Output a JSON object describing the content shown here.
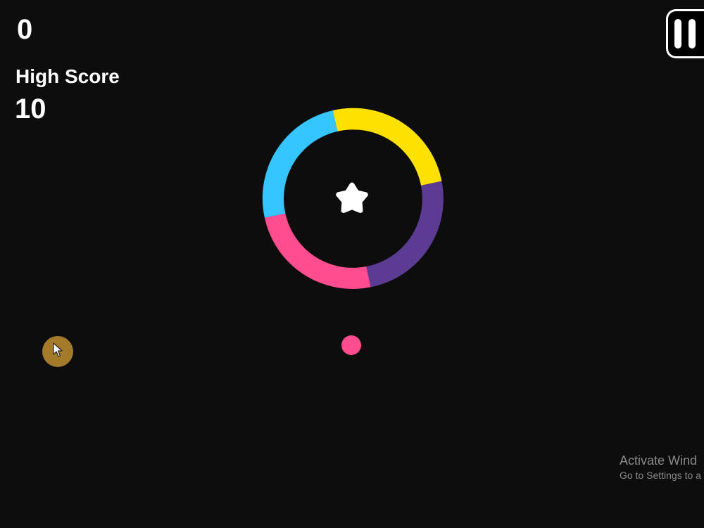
{
  "hud": {
    "score": "0",
    "high_score_label": "High Score",
    "high_score_value": "10"
  },
  "pause_button": {
    "icon": "pause-icon"
  },
  "game": {
    "ring_segments": [
      {
        "name": "yellow",
        "color": "#ffe100"
      },
      {
        "name": "purple",
        "color": "#5c3c93"
      },
      {
        "name": "pink",
        "color": "#ff4d8f"
      },
      {
        "name": "cyan",
        "color": "#35c6ff"
      }
    ],
    "star": {
      "icon": "star-icon",
      "color": "#ffffff"
    },
    "ball": {
      "color": "#ff4d8f"
    }
  },
  "cursor": {
    "icon": "mouse-pointer-icon",
    "color": "#a27a2a"
  },
  "watermark": {
    "title": "Activate Wind",
    "subtitle": "Go to Settings to a"
  }
}
